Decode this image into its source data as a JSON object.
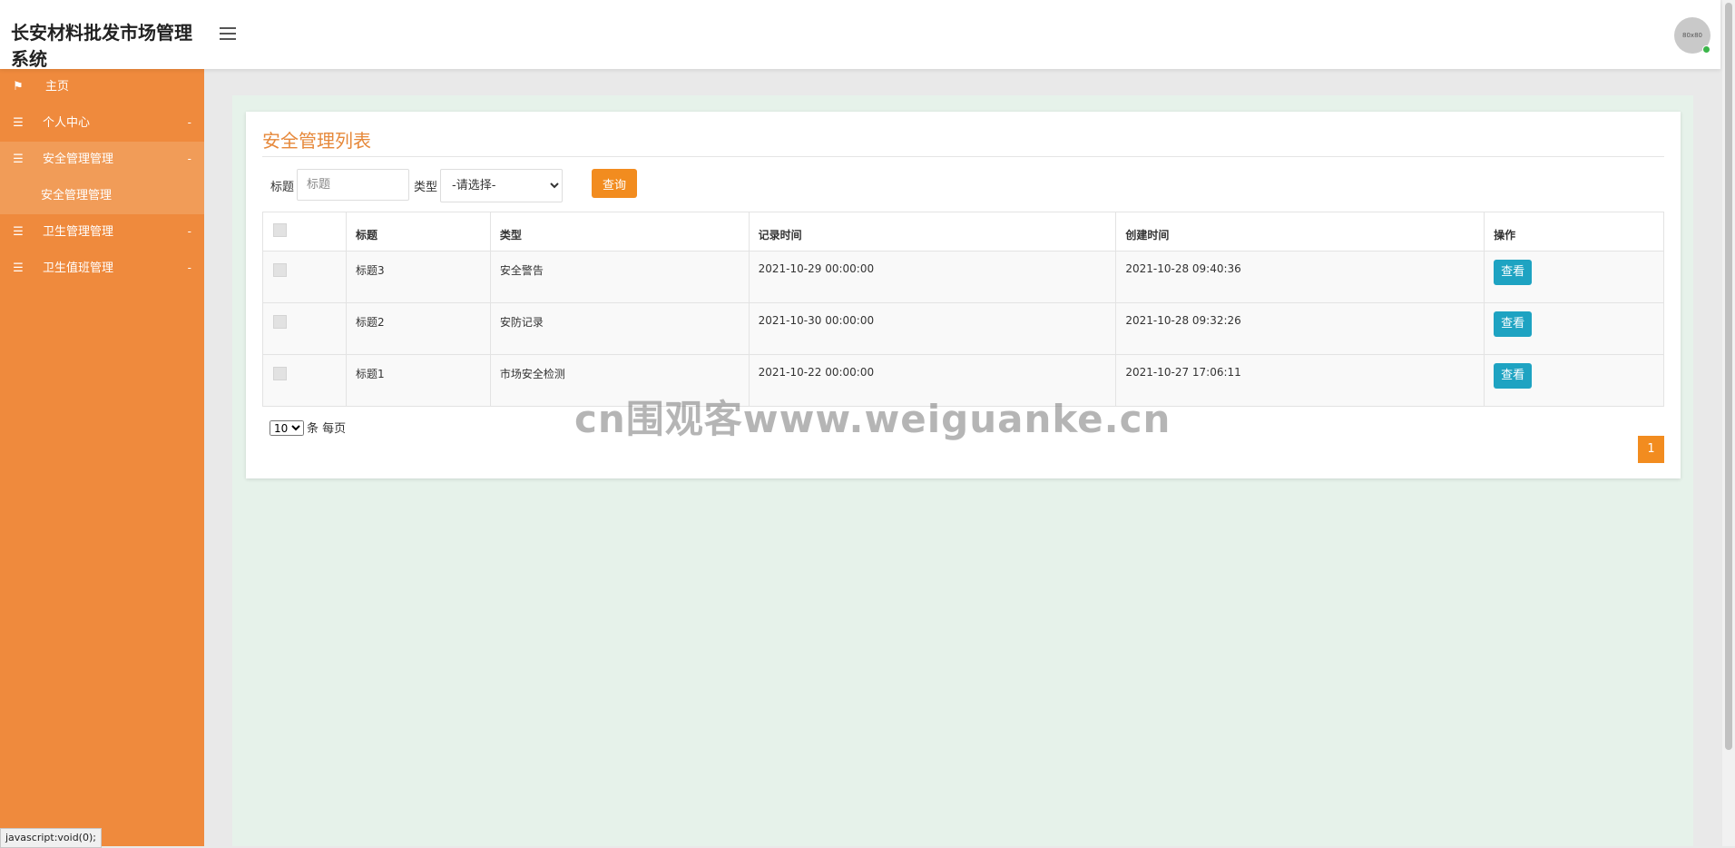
{
  "app": {
    "title": "长安材料批发市场管理系统",
    "avatar_text": "80x80"
  },
  "sidebar": {
    "items": [
      {
        "label": "主页",
        "icon": "flag-icon"
      },
      {
        "label": "个人中心",
        "icon": "list-icon"
      },
      {
        "label": "安全管理管理",
        "icon": "list-icon"
      },
      {
        "label": "卫生管理管理",
        "icon": "list-icon"
      },
      {
        "label": "卫生值班管理",
        "icon": "list-icon"
      }
    ],
    "sub_items": [
      {
        "label": "安全管理管理"
      }
    ]
  },
  "card": {
    "title": "安全管理列表"
  },
  "filter": {
    "title_label": "标题",
    "title_placeholder": "标题",
    "type_label": "类型",
    "type_selected": "-请选择-",
    "query_label": "查询"
  },
  "table": {
    "headers": [
      "标题",
      "类型",
      "记录时间",
      "创建时间",
      "操作"
    ],
    "rows": [
      {
        "title": "标题3",
        "type": "安全警告",
        "record_time": "2021-10-29 00:00:00",
        "created_time": "2021-10-28 09:40:36",
        "action": "查看"
      },
      {
        "title": "标题2",
        "type": "安防记录",
        "record_time": "2021-10-30 00:00:00",
        "created_time": "2021-10-28 09:32:26",
        "action": "查看"
      },
      {
        "title": "标题1",
        "type": "市场安全检测",
        "record_time": "2021-10-22 00:00:00",
        "created_time": "2021-10-27 17:06:11",
        "action": "查看"
      }
    ]
  },
  "pagination": {
    "page_size": "10",
    "per_page_label": "条 每页",
    "current_page": "1"
  },
  "watermark": "cn围观客www.weiguanke.cn",
  "status_bar": "javascript:void(0);",
  "colors": {
    "sidebar": "#ef8a3d",
    "accent": "#f28c1f",
    "view_button": "#1ea3c2",
    "title": "#e6883a"
  }
}
